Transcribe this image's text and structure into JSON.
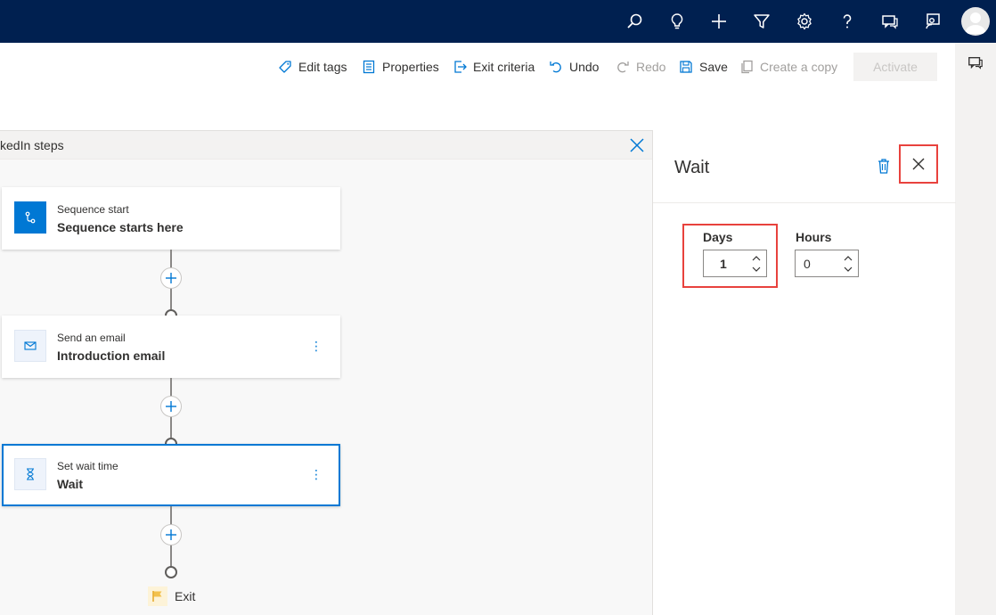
{
  "topbar": {
    "icons": [
      "search-icon",
      "lightbulb-icon",
      "plus-icon",
      "filter-icon",
      "gear-icon",
      "help-icon",
      "chat-icon",
      "assistant-icon"
    ]
  },
  "commandbar": {
    "edit_tags": "Edit tags",
    "properties": "Properties",
    "exit_criteria": "Exit criteria",
    "undo": "Undo",
    "redo": "Redo",
    "save": "Save",
    "create_copy": "Create a copy",
    "activate": "Activate"
  },
  "canvas": {
    "header_title": "kedIn steps",
    "steps": [
      {
        "subtitle": "Sequence start",
        "title": "Sequence starts here"
      },
      {
        "subtitle": "Send an email",
        "title": "Introduction email"
      },
      {
        "subtitle": "Set wait time",
        "title": "Wait"
      }
    ],
    "exit_label": "Exit"
  },
  "panel": {
    "title": "Wait",
    "days_label": "Days",
    "days_value": "1",
    "hours_label": "Hours",
    "hours_value": "0"
  },
  "colors": {
    "topbar_bg": "#002050",
    "accent": "#0078d4",
    "highlight": "#e8423d"
  }
}
